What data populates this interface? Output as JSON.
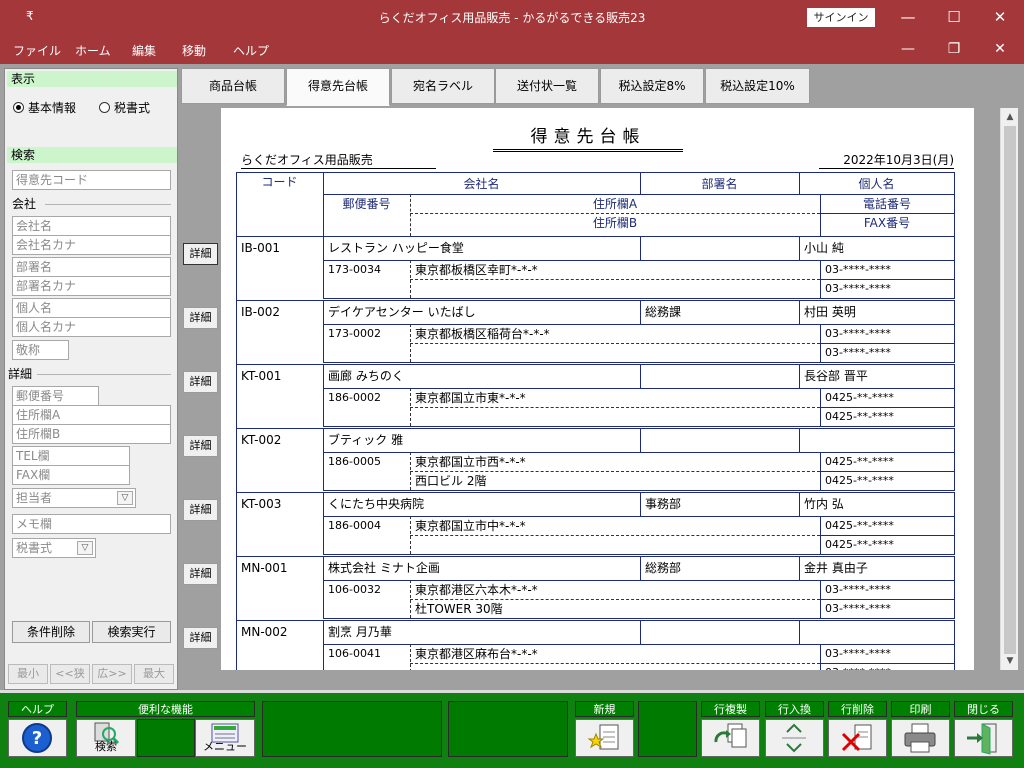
{
  "window": {
    "title": "らくだオフィス用品販売 - かるがるできる販売23",
    "signin": "サインイン",
    "grip": "₹"
  },
  "menu": {
    "file": "ファイル",
    "home": "ホーム",
    "edit": "編集",
    "move": "移動",
    "help": "ヘルプ"
  },
  "left": {
    "display_header": "表示",
    "radio_basic": "基本情報",
    "radio_honorific": "税書式",
    "search_header": "検索",
    "customer_code": "得意先コード",
    "company_group": "会社",
    "company_name": "会社名",
    "company_kana": "会社名カナ",
    "dept": "部署名",
    "dept_kana": "部署名カナ",
    "person": "個人名",
    "person_kana": "個人名カナ",
    "honorific": "敬称",
    "detail_group": "詳細",
    "postal": "郵便番号",
    "addr_a": "住所欄A",
    "addr_b": "住所欄B",
    "tel": "TEL欄",
    "fax": "FAX欄",
    "staff": "担当者",
    "memo": "メモ欄",
    "tax": "税書式",
    "clear_btn": "条件削除",
    "search_btn": "検索実行",
    "nav_min": "最小",
    "nav_prev": "<<狭",
    "nav_next": "広>>",
    "nav_max": "最大"
  },
  "tabs": [
    "商品台帳",
    "得意先台帳",
    "宛名ラベル",
    "送付状一覧",
    "税込設定8%",
    "税込設定10%"
  ],
  "sheet": {
    "title": "得意先台帳",
    "company": "らくだオフィス用品販売",
    "date": "2022年10月3日(月)",
    "header": {
      "code": "コード",
      "company": "会社名",
      "dept": "部署名",
      "person": "個人名",
      "postal": "郵便番号",
      "addr_a": "住所欄A",
      "addr_b": "住所欄B",
      "phone": "電話番号",
      "fax": "FAX番号"
    },
    "detail_label": "詳細",
    "rows": [
      {
        "code": "IB-001",
        "company": "レストラン ハッピー食堂",
        "dept": "",
        "person": "小山 純",
        "postal": "173-0034",
        "addr_a": "東京都板橋区幸町*-*-*",
        "addr_b": "",
        "phone": "03-****-****",
        "fax": "03-****-****"
      },
      {
        "code": "IB-002",
        "company": "デイケアセンター いたばし",
        "dept": "総務課",
        "person": "村田 英明",
        "postal": "173-0002",
        "addr_a": "東京都板橋区稲荷台*-*-*",
        "addr_b": "",
        "phone": "03-****-****",
        "fax": "03-****-****"
      },
      {
        "code": "KT-001",
        "company": "画廊 みちのく",
        "dept": "",
        "person": "長谷部 晋平",
        "postal": "186-0002",
        "addr_a": "東京都国立市東*-*-*",
        "addr_b": "",
        "phone": "0425-**-****",
        "fax": "0425-**-****"
      },
      {
        "code": "KT-002",
        "company": "ブティック 雅",
        "dept": "",
        "person": "",
        "postal": "186-0005",
        "addr_a": "東京都国立市西*-*-*",
        "addr_b": "西口ビル 2階",
        "phone": "0425-**-****",
        "fax": "0425-**-****"
      },
      {
        "code": "KT-003",
        "company": "くにたち中央病院",
        "dept": "事務部",
        "person": "竹内 弘",
        "postal": "186-0004",
        "addr_a": "東京都国立市中*-*-*",
        "addr_b": "",
        "phone": "0425-**-****",
        "fax": "0425-**-****"
      },
      {
        "code": "MN-001",
        "company": "株式会社 ミナト企画",
        "dept": "総務部",
        "person": "金井 真由子",
        "postal": "106-0032",
        "addr_a": "東京都港区六本木*-*-*",
        "addr_b": "杜TOWER 30階",
        "phone": "03-****-****",
        "fax": "03-****-****"
      },
      {
        "code": "MN-002",
        "company": "割烹 月乃華",
        "dept": "",
        "person": "",
        "postal": "106-0041",
        "addr_a": "東京都港区麻布台*-*-*",
        "addr_b": "",
        "phone": "03-****-****",
        "fax": "03-****-****"
      }
    ]
  },
  "toolbar": {
    "help": "ヘルプ",
    "convenient": "便利な機能",
    "search": "検索",
    "menu": "メニュー",
    "new": "新規",
    "copy_row": "行複製",
    "swap_row": "行入換",
    "delete_row": "行削除",
    "print": "印刷",
    "close": "閉じる"
  },
  "colors": {
    "titlebar": "#a4373a",
    "toolbar": "#108010",
    "section": "#ccf5cc",
    "grid": "#1e2b78"
  }
}
